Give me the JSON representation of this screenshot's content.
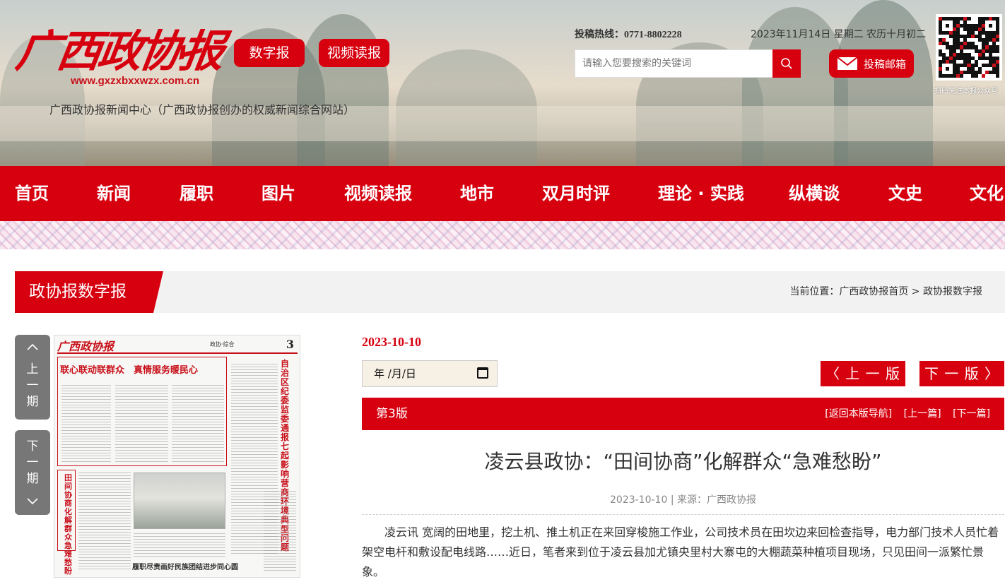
{
  "header": {
    "logo_text": "广西政协报",
    "logo_url": "www.gxzxbxxwzx.com.cn",
    "site_desc": "广西政协报新闻中心（广西政协报创办的权威新闻综合网站）",
    "digital_btn": "数字报",
    "video_btn": "视频读报",
    "hotline": "投稿热线：0771-8802228",
    "date": "2023年11月14日 星期二 农历十月初二",
    "search_placeholder": "请输入您要搜索的关键词",
    "mail_btn": "投稿邮箱",
    "qr_caption": "扫码关注本报公众号"
  },
  "nav": [
    "首页",
    "新闻",
    "履职",
    "图片",
    "视频读报",
    "地市",
    "双月时评",
    "理论 · 实践",
    "纵横谈",
    "文史",
    "文化"
  ],
  "section": {
    "title": "政协报数字报",
    "crumb_prefix": "当前位置：",
    "crumb_home": "广西政协报首页",
    "crumb_sep": " > ",
    "crumb_current": "政协报数字报"
  },
  "pager": {
    "prev_label": [
      "上",
      "一",
      "期"
    ],
    "next_label": [
      "下",
      "一",
      "期"
    ]
  },
  "paper": {
    "masthead": "广西政协报",
    "page_caption": "政协·综合",
    "page_number": "3",
    "headline1": "联心联动联群众　真情服务暖民心",
    "headline2": "自治区纪委监委通报七起影响营商环境典型问题",
    "headline3": "田间协商化解群众急难愁盼",
    "headline4": "履职尽责画好民族团结进步同心圆"
  },
  "reader": {
    "date": "2023-10-10",
    "date_input": "年 /月/日",
    "prev_version": "〈 上 一 版",
    "next_version": "下 一 版 〉",
    "edition": "第3版",
    "link_back": "[返回本版导航]",
    "link_prev": "[上一篇]",
    "link_next": "[下一篇]"
  },
  "article": {
    "title": "凌云县政协：“田间协商”化解群众“急难愁盼”",
    "meta_date": "2023-10-10",
    "meta_sep": " | 来源：",
    "meta_source": "广西政协报",
    "body": "凌云讯 宽阔的田地里，挖土机、推土机正在来回穿梭施工作业，公司技术员在田坎边来回检查指导，电力部门技术人员忙着架空电杆和敷设配电线路……近日，笔者来到位于凌云县加尤镇央里村大寨屯的大棚蔬菜种植项目现场，只见田间一派繁忙景象。"
  },
  "colors": {
    "brand_red": "#d7000f",
    "gray_button": "#777777"
  }
}
